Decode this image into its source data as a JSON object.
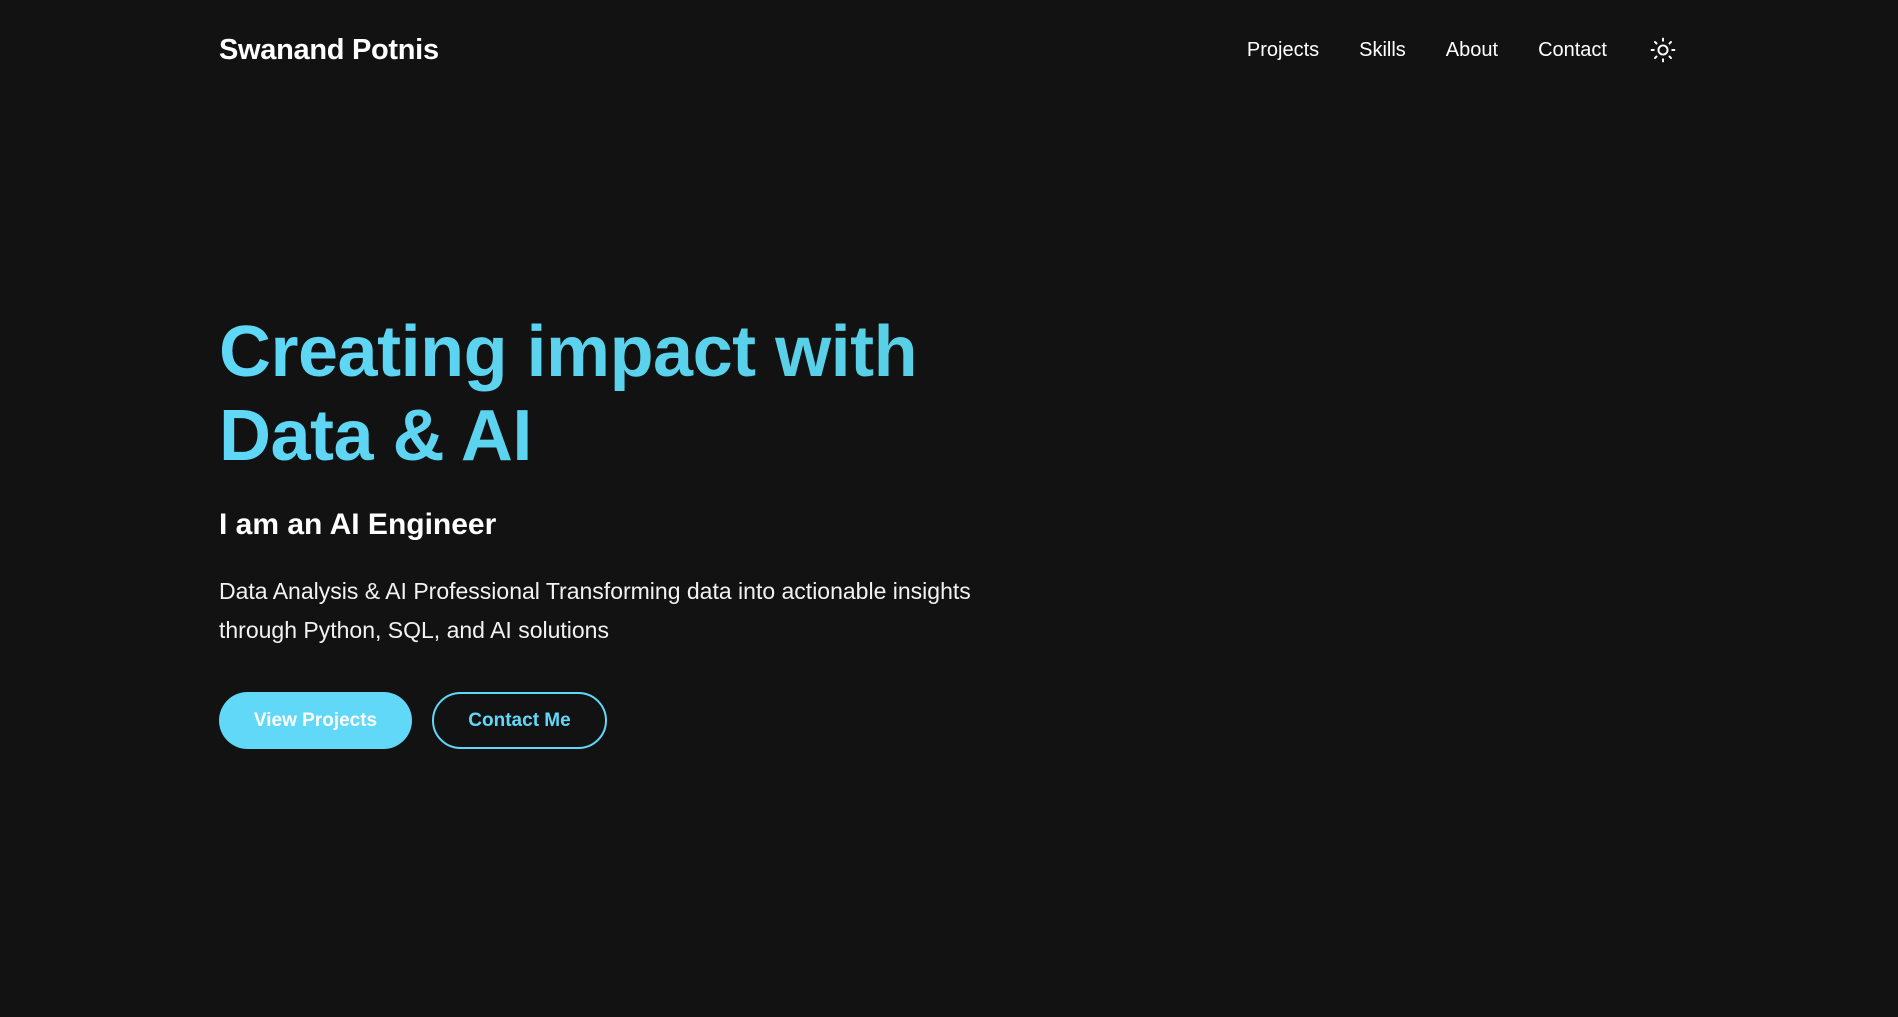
{
  "header": {
    "brand": "Swanand Potnis",
    "nav": {
      "projects": "Projects",
      "skills": "Skills",
      "about": "About",
      "contact": "Contact"
    },
    "theme_icon": "sun-icon"
  },
  "hero": {
    "headline_line1": "Creating impact with",
    "headline_line2": "Data & AI",
    "subheadline": "I am an AI Engineer",
    "description": "Data Analysis & AI Professional Transforming data into actionable insights through Python, SQL, and AI solutions",
    "primary_button": "View Projects",
    "secondary_button": "Contact Me"
  },
  "colors": {
    "background": "#121212",
    "accent": "#61d8f8",
    "text": "#ffffff"
  }
}
